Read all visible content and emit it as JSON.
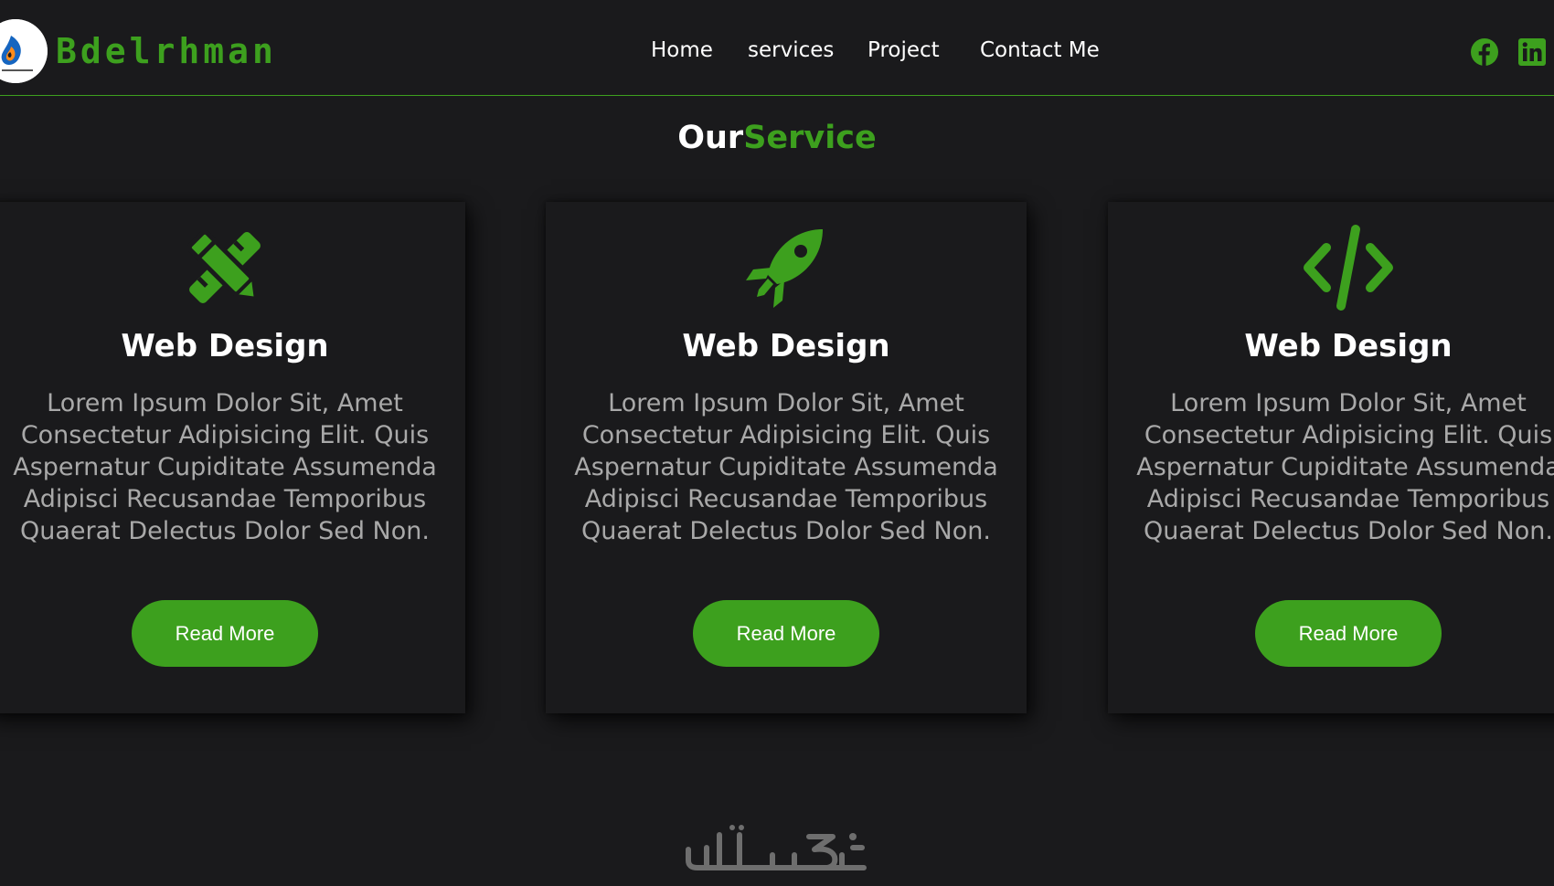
{
  "header": {
    "brand": "Bdelrhman",
    "nav": [
      "Home",
      "services",
      "Project",
      "Contact Me"
    ],
    "social": [
      "facebook-icon",
      "linkedin-icon"
    ]
  },
  "section": {
    "title_white": "Our",
    "title_green": "Service"
  },
  "cards": [
    {
      "icon": "pencil-ruler-icon",
      "title": "Web Design",
      "text": "Lorem Ipsum Dolor Sit, Amet Consectetur Adipisicing Elit. Quis Aspernatur Cupiditate Assumenda Adipisci Recusandae Temporibus Quaerat Delectus Dolor Sed Non.",
      "button": "Read More"
    },
    {
      "icon": "rocket-icon",
      "title": "Web Design",
      "text": "Lorem Ipsum Dolor Sit, Amet Consectetur Adipisicing Elit. Quis Aspernatur Cupiditate Assumenda Adipisci Recusandae Temporibus Quaerat Delectus Dolor Sed Non.",
      "button": "Read More"
    },
    {
      "icon": "code-icon",
      "title": "Web Design",
      "text": "Lorem Ipsum Dolor Sit, Amet Consectetur Adipisicing Elit. Quis Aspernatur Cupiditate Assumenda Adipisci Recusandae Temporibus Quaerat Delectus Dolor Sed Non.",
      "button": "Read More"
    }
  ],
  "watermark": "خمسات",
  "colors": {
    "accent": "#3da01e",
    "background": "#1a1a1c",
    "body_text": "#a9a9a9"
  }
}
